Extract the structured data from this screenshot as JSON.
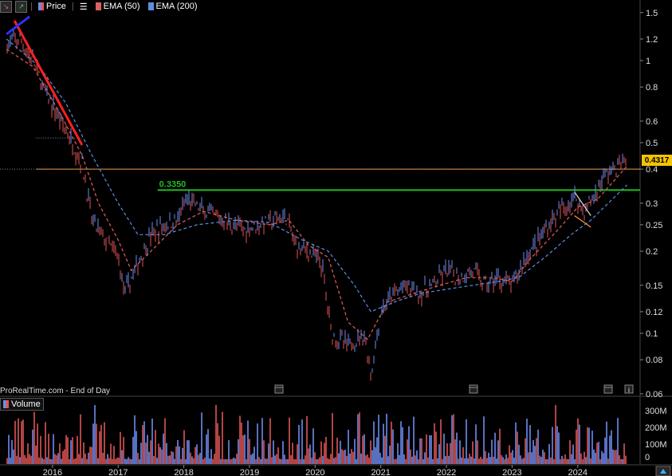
{
  "toolbar": {
    "price_label": "Price",
    "ema50_label": "EMA (50)",
    "ema200_label": "EMA (200)"
  },
  "brand": "ProRealTime.com - End of Day",
  "volume_label": "Volume",
  "last_price": "0.4317",
  "level_label": "0.3350",
  "colors": {
    "up": "#6e8cf0",
    "down": "#e05555",
    "ema50": "#e06060",
    "ema200": "#5c8fe0",
    "support_line": "#22bb22",
    "resistance_line": "#ff9a3c",
    "trend_down": "#ff2020",
    "trend_blue": "#3030ff",
    "price_badge": "#f5c400"
  },
  "chart_data": {
    "type": "line",
    "scale": "log",
    "x_ticks": [
      "2016",
      "2017",
      "2018",
      "2019",
      "2020",
      "2021",
      "2022",
      "2023",
      "2024"
    ],
    "y_ticks": [
      "1.5",
      "1.2",
      "1",
      "0.8",
      "0.6",
      "0.5",
      "0.4",
      "0.3",
      "0.25",
      "0.2",
      "0.15",
      "0.12",
      "0.1",
      "0.08",
      "0.06"
    ],
    "volume_ticks": [
      "300M",
      "200M",
      "100M",
      "0"
    ],
    "ylim": [
      0.06,
      1.6
    ],
    "series": [
      {
        "name": "Price",
        "x": [
          2015.3,
          2015.5,
          2015.7,
          2015.9,
          2016.1,
          2016.3,
          2016.45,
          2016.6,
          2016.8,
          2017.0,
          2017.1,
          2017.3,
          2017.5,
          2017.7,
          2017.9,
          2018.05,
          2018.3,
          2018.6,
          2018.9,
          2019.1,
          2019.4,
          2019.55,
          2019.7,
          2019.9,
          2020.1,
          2020.25,
          2020.5,
          2020.75,
          2020.85,
          2021.0,
          2021.2,
          2021.4,
          2021.6,
          2021.8,
          2022.0,
          2022.2,
          2022.4,
          2022.6,
          2022.8,
          2023.0,
          2023.2,
          2023.4,
          2023.6,
          2023.8,
          2023.95,
          2024.1,
          2024.25,
          2024.4,
          2024.6,
          2024.75
        ],
        "values": [
          1.15,
          1.2,
          1.0,
          0.75,
          0.62,
          0.5,
          0.42,
          0.26,
          0.22,
          0.19,
          0.14,
          0.18,
          0.23,
          0.25,
          0.26,
          0.31,
          0.28,
          0.26,
          0.24,
          0.25,
          0.26,
          0.27,
          0.21,
          0.2,
          0.18,
          0.1,
          0.09,
          0.1,
          0.07,
          0.12,
          0.14,
          0.15,
          0.14,
          0.15,
          0.17,
          0.16,
          0.17,
          0.15,
          0.16,
          0.15,
          0.19,
          0.22,
          0.26,
          0.29,
          0.32,
          0.28,
          0.32,
          0.38,
          0.41,
          0.43
        ]
      },
      {
        "name": "EMA (50)",
        "x": [
          2015.3,
          2015.7,
          2016.1,
          2016.45,
          2016.7,
          2017.0,
          2017.2,
          2017.5,
          2017.9,
          2018.3,
          2018.8,
          2019.3,
          2019.6,
          2019.9,
          2020.2,
          2020.5,
          2020.8,
          2021.1,
          2021.5,
          2021.9,
          2022.3,
          2022.7,
          2023.0,
          2023.3,
          2023.7,
          2024.0,
          2024.3,
          2024.75
        ],
        "values": [
          1.1,
          0.95,
          0.65,
          0.45,
          0.3,
          0.22,
          0.17,
          0.2,
          0.25,
          0.28,
          0.26,
          0.25,
          0.26,
          0.21,
          0.19,
          0.11,
          0.095,
          0.13,
          0.14,
          0.15,
          0.16,
          0.16,
          0.155,
          0.19,
          0.24,
          0.29,
          0.31,
          0.41
        ]
      },
      {
        "name": "EMA (200)",
        "x": [
          2015.3,
          2015.8,
          2016.2,
          2016.6,
          2017.0,
          2017.3,
          2017.7,
          2018.2,
          2018.8,
          2019.3,
          2019.8,
          2020.2,
          2020.6,
          2020.85,
          2021.2,
          2021.6,
          2022.0,
          2022.4,
          2022.8,
          2023.1,
          2023.5,
          2023.9,
          2024.2,
          2024.75
        ],
        "values": [
          1.2,
          0.95,
          0.7,
          0.45,
          0.3,
          0.23,
          0.23,
          0.25,
          0.26,
          0.255,
          0.22,
          0.2,
          0.15,
          0.12,
          0.13,
          0.14,
          0.145,
          0.15,
          0.155,
          0.16,
          0.19,
          0.23,
          0.26,
          0.35
        ]
      }
    ],
    "horizontal_lines": [
      {
        "value": 0.335,
        "label": "0.3350",
        "color": "#22bb22",
        "x_start": 2017.6
      },
      {
        "value": 0.4,
        "label": "",
        "color": "#ff9a3c",
        "x_start": 2015.75
      }
    ],
    "trendlines": [
      {
        "x1": 2015.42,
        "y1": 1.4,
        "x2": 2016.45,
        "y2": 0.49,
        "color": "#ff2020"
      },
      {
        "x1": 2015.3,
        "y1": 1.25,
        "x2": 2015.65,
        "y2": 1.45,
        "color": "#3030ff"
      }
    ],
    "legend": "top-left"
  }
}
